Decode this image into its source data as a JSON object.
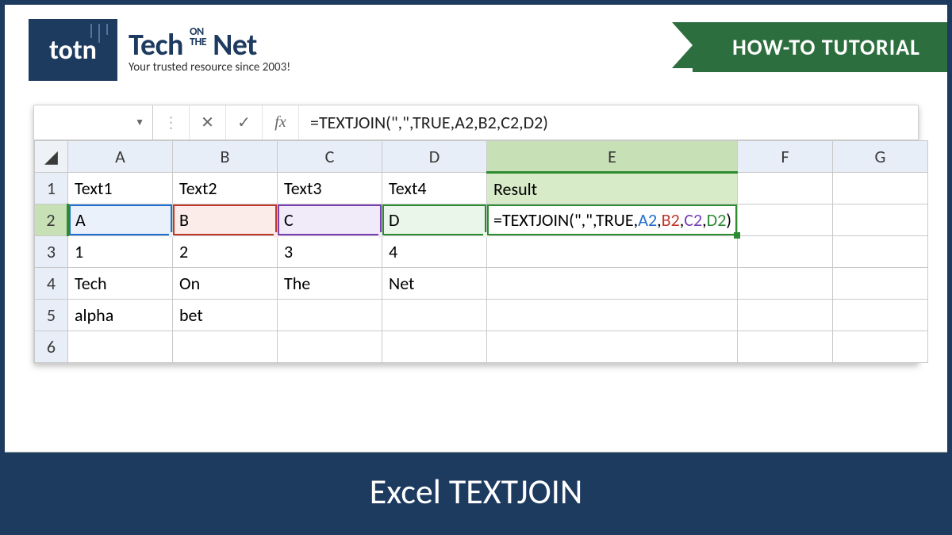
{
  "brand": {
    "logo_text": "totn",
    "title_tech": "Tech",
    "title_on": "ON",
    "title_the": "THE",
    "title_net": "Net",
    "tagline": "Your trusted resource since 2003!"
  },
  "ribbon": {
    "label": "HOW-TO TUTORIAL"
  },
  "formula_bar": {
    "name_box": "",
    "cancel": "✕",
    "enter": "✓",
    "fx": "fx",
    "formula": "=TEXTJOIN(\",\",TRUE,A2,B2,C2,D2)"
  },
  "columns": [
    "A",
    "B",
    "C",
    "D",
    "E",
    "F",
    "G"
  ],
  "rows": [
    "1",
    "2",
    "3",
    "4",
    "5",
    "6"
  ],
  "grid": {
    "r1": {
      "A": "Text1",
      "B": "Text2",
      "C": "Text3",
      "D": "Text4",
      "E": "Result",
      "F": "",
      "G": ""
    },
    "r2": {
      "A": "A",
      "B": "B",
      "C": "C",
      "D": "D",
      "E_prefix": "=TEXTJOIN(\",\",TRUE,",
      "E_a": "A2",
      "E_b": "B2",
      "E_c": "C2",
      "E_d": "D2",
      "E_suffix": ")",
      "F": "",
      "G": ""
    },
    "r3": {
      "A": "1",
      "B": "2",
      "C": "3",
      "D": "4",
      "E": "",
      "F": "",
      "G": ""
    },
    "r4": {
      "A": "Tech",
      "B": "On",
      "C": "The",
      "D": "Net",
      "E": "",
      "F": "",
      "G": ""
    },
    "r5": {
      "A": "alpha",
      "B": "bet",
      "C": "",
      "D": "",
      "E": "",
      "F": "",
      "G": ""
    },
    "r6": {
      "A": "",
      "B": "",
      "C": "",
      "D": "",
      "E": "",
      "F": "",
      "G": ""
    }
  },
  "banner": {
    "title": "Excel TEXTJOIN"
  },
  "colors": {
    "navy": "#1d3a5f",
    "green_ribbon": "#2d6e3e",
    "ref_a": "#1f6fd0",
    "ref_b": "#c0392b",
    "ref_c": "#7a3fb5",
    "ref_d": "#2d8b32"
  },
  "active_cell": "E2"
}
